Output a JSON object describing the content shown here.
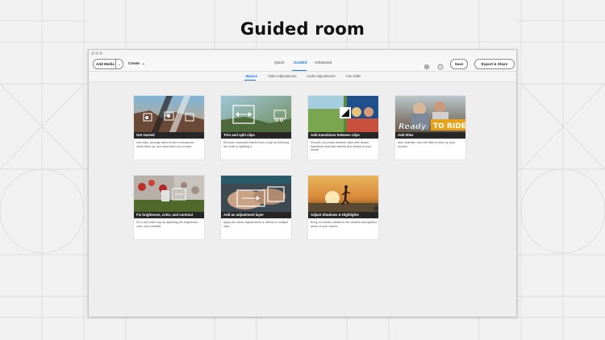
{
  "page_title": "Guided room",
  "toolbar": {
    "add_media": "Add Media",
    "create": "Create",
    "modes": [
      "Quick",
      "Guided",
      "Advanced"
    ],
    "active_mode": "Guided",
    "save": "Save",
    "export": "Export & Share",
    "icons": [
      "gear-icon",
      "help-icon"
    ]
  },
  "subtabs": [
    "Basics",
    "Video Adjustments",
    "Audio Adjustments",
    "Fun Edits"
  ],
  "active_subtab": "Basics",
  "cards": [
    {
      "title": "Get started",
      "desc": "Add clips, arrange them to form a sequence, clean them up, and save them as a movie."
    },
    {
      "title": "Trim and split clips",
      "desc": "Remove unwanted frames from a clip by trimming the ends or splitting it."
    },
    {
      "title": "Add transitions between clips",
      "desc": "Smooth out jumps between clips with simple transitions that add interest and drama to your movie."
    },
    {
      "title": "Add titles",
      "desc": "Add, animate, and edit titles to liven up your movies.",
      "overlay_text": "Ready TO RIDE!"
    },
    {
      "title": "Fix brightness, color, and contrast",
      "desc": "Fix a dull video clip by adjusting the brightness, color, and contrast."
    },
    {
      "title": "Add an adjustment layer",
      "desc": "Apply the same adjustments or effects to multiple clips."
    },
    {
      "title": "Adjust Shadows & Highlights",
      "desc": "Bring out hidden details in the darkest and lightest areas of your videos."
    }
  ],
  "colors": {
    "accent": "#1473e6",
    "caption_bg": "#141414"
  }
}
